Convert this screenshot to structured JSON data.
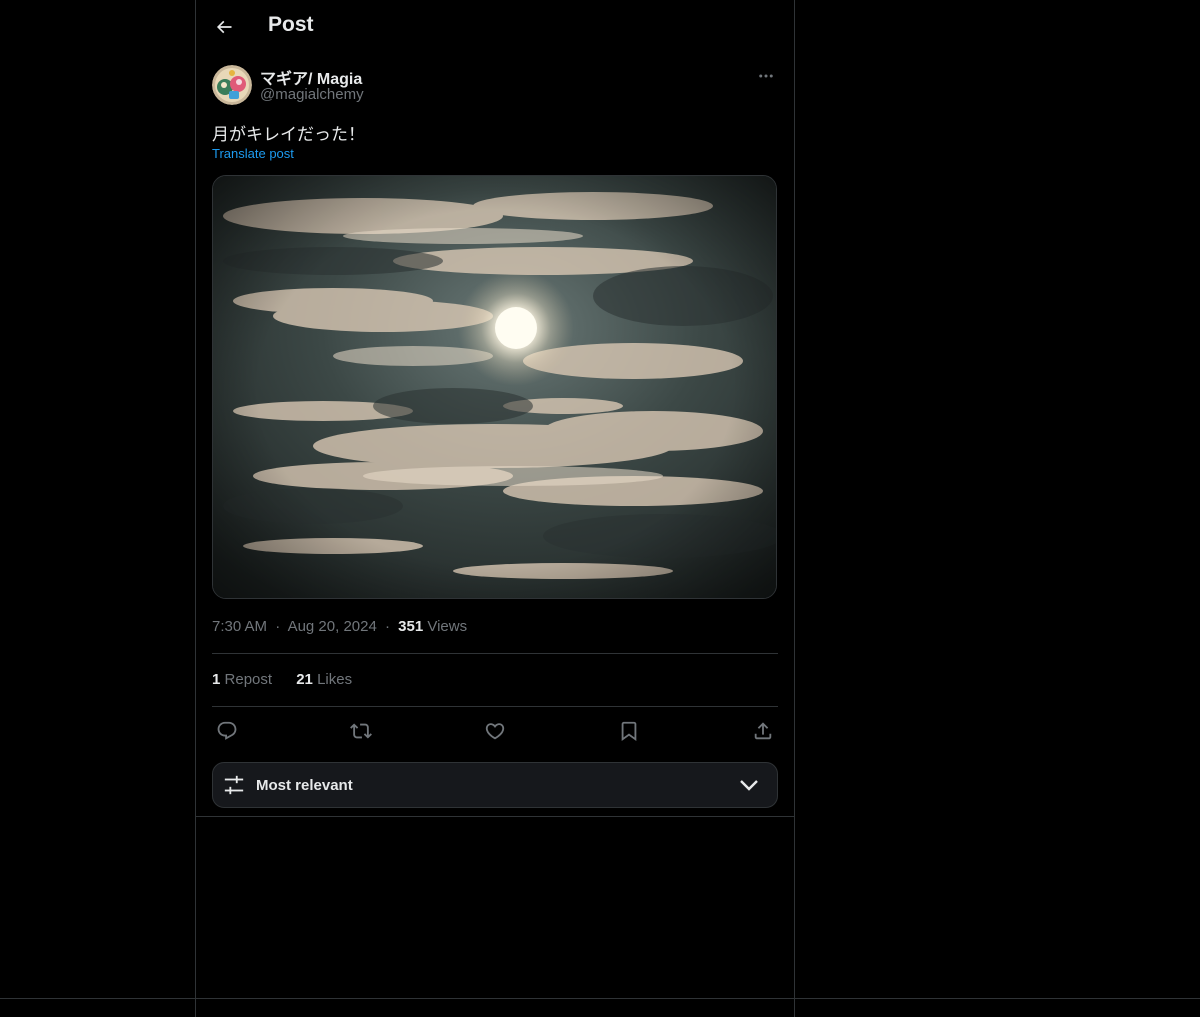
{
  "header": {
    "title": "Post"
  },
  "author": {
    "name": "マギア/ Magia",
    "handle": "@magialchemy"
  },
  "post": {
    "text": "月がキレイだった！",
    "translate_label": "Translate post",
    "media_alt": "Full moon behind clouds at night"
  },
  "meta": {
    "time": "7:30 AM",
    "date": "Aug 20, 2024",
    "views_count": "351",
    "views_label": "Views",
    "separator": "·"
  },
  "stats": {
    "reposts_count": "1",
    "reposts_label": "Repost",
    "likes_count": "21",
    "likes_label": "Likes"
  },
  "actions": [
    "reply-icon",
    "repost-icon",
    "like-icon",
    "bookmark-icon",
    "share-icon"
  ],
  "sort": {
    "label": "Most relevant"
  },
  "colors": {
    "background": "#000000",
    "text": "#e7e9ea",
    "secondary": "#71767b",
    "link": "#1d9bf0",
    "border": "#2f3336"
  }
}
